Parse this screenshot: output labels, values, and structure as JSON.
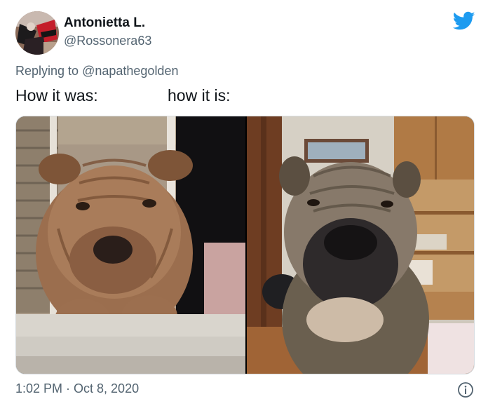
{
  "author": {
    "name": "Antonietta L.",
    "handle": "@Rossonera63"
  },
  "reply": {
    "prefix": "Replying to",
    "mention": "@napathegolden"
  },
  "text": {
    "left": "How it was:",
    "right": "how it is:"
  },
  "media": {
    "left_image": "shar-pei-puppy-photo",
    "right_image": "shar-pei-adult-photo"
  },
  "meta": {
    "timestamp": "1:02 PM · Oct 8, 2020"
  },
  "icons": {
    "brand": "twitter-bird-icon",
    "info": "info-icon"
  },
  "colors": {
    "brand": "#1d9bf0",
    "secondary_text": "#536471",
    "primary_text": "#0f1419"
  }
}
